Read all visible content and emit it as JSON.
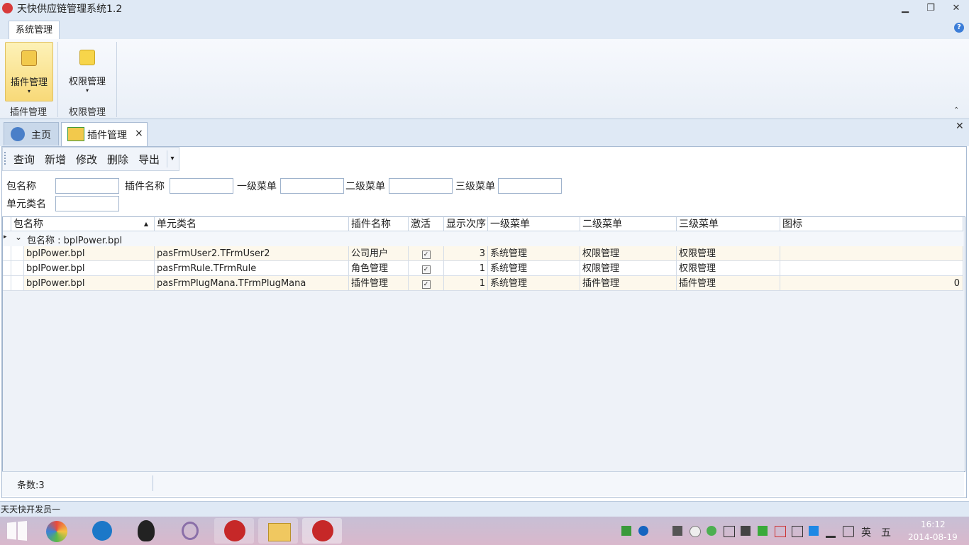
{
  "window": {
    "title": "天快供应链管理系统1.2",
    "minimize": "▁",
    "restore": "❐",
    "close": "✕"
  },
  "ribbon": {
    "tabs": [
      "系统管理"
    ],
    "buttons": [
      {
        "label": "插件管理",
        "arrow": "▾"
      },
      {
        "label": "权限管理",
        "arrow": "▾"
      }
    ],
    "groups": [
      "插件管理",
      "权限管理"
    ],
    "help": "?",
    "collapse": "⌃"
  },
  "doc_tabs": [
    {
      "label": "主页"
    },
    {
      "label": "插件管理",
      "close": "×"
    }
  ],
  "close_all": "✕",
  "toolbar": {
    "query": "查询",
    "add": "新增",
    "edit": "修改",
    "delete": "删除",
    "export": "导出",
    "more": "▾"
  },
  "filters": {
    "package": "包名称",
    "plugin": "插件名称",
    "menu1": "一级菜单",
    "menu2": "二级菜单",
    "menu3": "三级菜单",
    "unit": "单元类名"
  },
  "grid": {
    "columns": [
      "包名称",
      "单元类名",
      "插件名称",
      "激活",
      "显示次序",
      "一级菜单",
      "二级菜单",
      "三级菜单",
      "图标"
    ],
    "sort_indicator": "▲",
    "group_row": {
      "label": "包名称 : bplPower.bpl",
      "expand": "⌄",
      "indicator": "▸"
    },
    "rows": [
      {
        "package": "bplPower.bpl",
        "unit": "pasFrmUser2.TFrmUser2",
        "plugin": "公司用户",
        "active": "✓",
        "order": "3",
        "menu1": "系统管理",
        "menu2": "权限管理",
        "menu3": "权限管理",
        "icon": ""
      },
      {
        "package": "bplPower.bpl",
        "unit": "pasFrmRule.TFrmRule",
        "plugin": "角色管理",
        "active": "✓",
        "order": "1",
        "menu1": "系统管理",
        "menu2": "权限管理",
        "menu3": "权限管理",
        "icon": ""
      },
      {
        "package": "bplPower.bpl",
        "unit": "pasFrmPlugMana.TFrmPlugMana",
        "plugin": "插件管理",
        "active": "✓",
        "order": "1",
        "menu1": "系统管理",
        "menu2": "插件管理",
        "menu3": "插件管理",
        "icon": "0"
      }
    ]
  },
  "footer": {
    "count": "条数:3"
  },
  "status": {
    "user": "天天快开发员一"
  },
  "taskbar": {
    "ime_lang": "英",
    "ime_mode": "五",
    "time": "16:12",
    "date": "2014-08-19"
  }
}
